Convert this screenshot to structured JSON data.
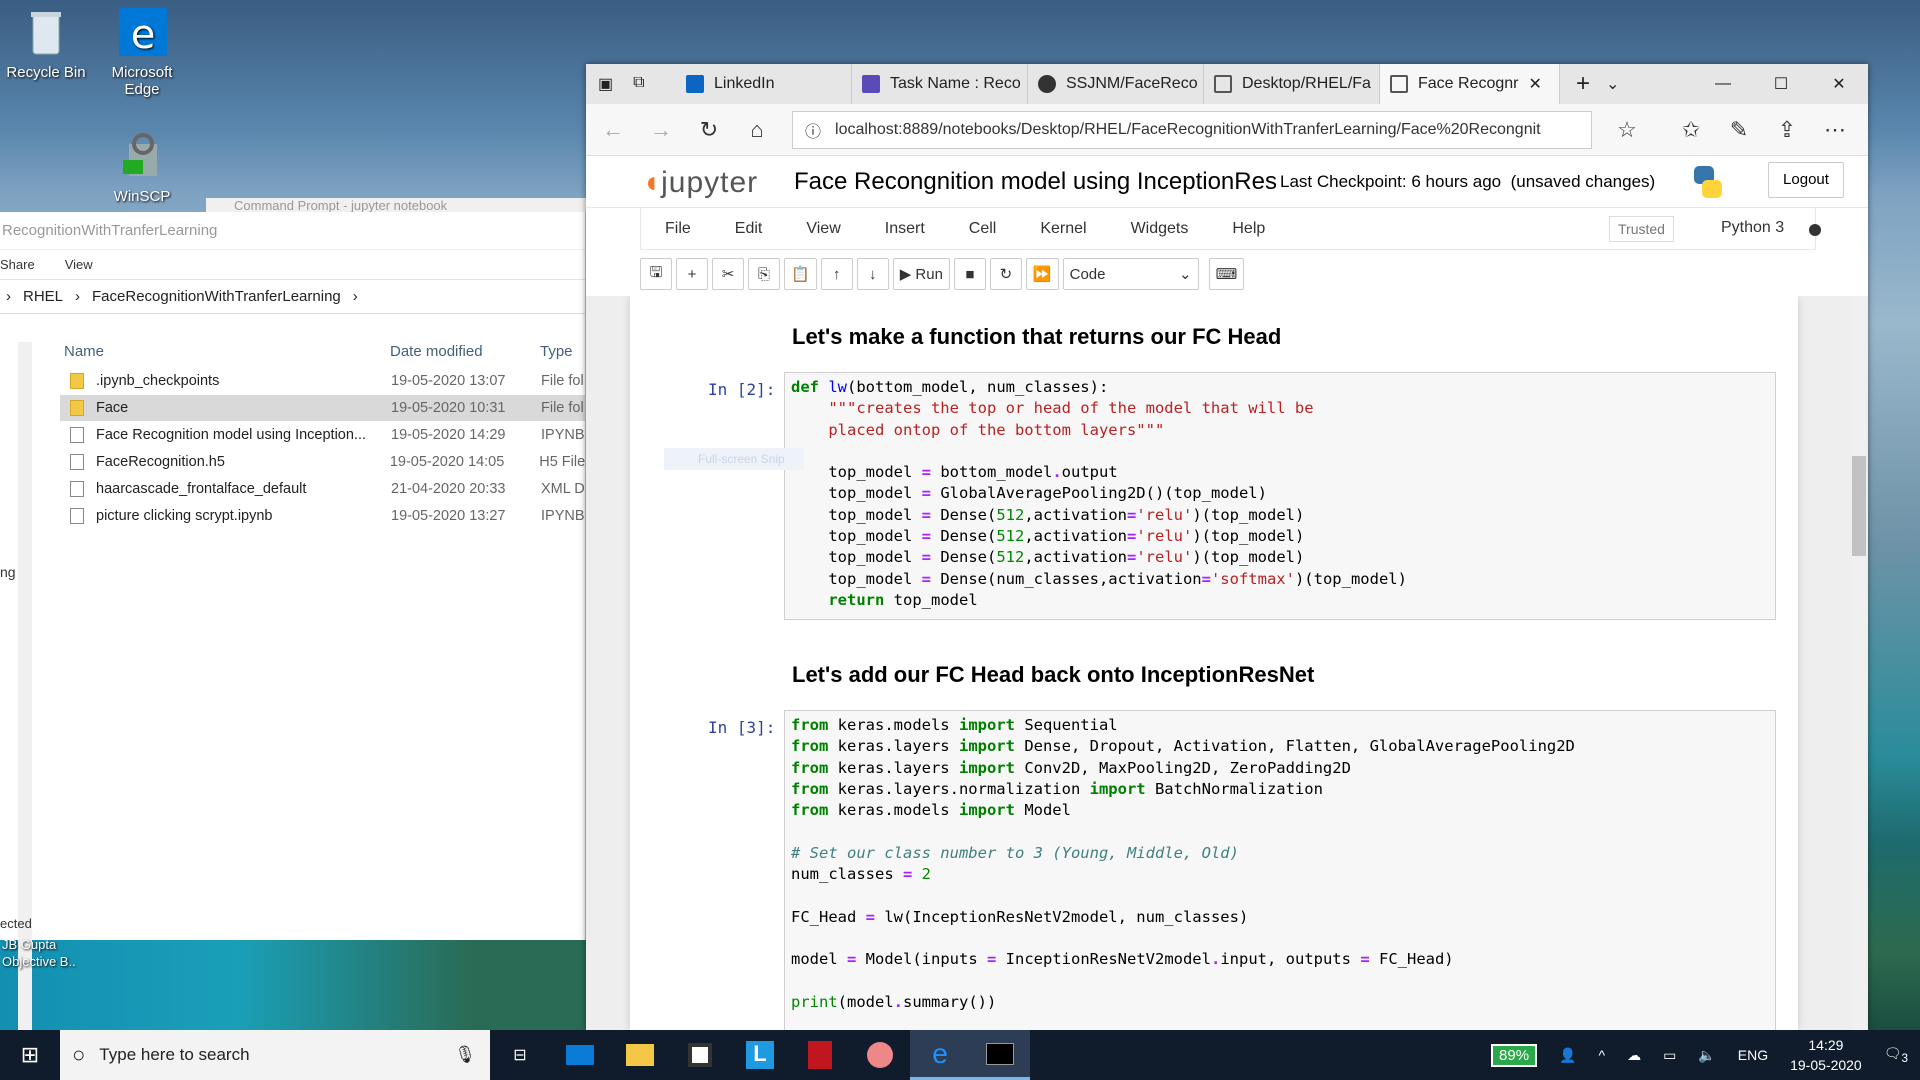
{
  "desktop": {
    "icons": [
      {
        "label": "Recycle Bin"
      },
      {
        "label": "Microsoft Edge"
      },
      {
        "label": "WinSCP"
      }
    ],
    "cmd_title": "Command Prompt - jupyter  notebook",
    "bottom_text": [
      "JB Gupta",
      "Objective  B.."
    ]
  },
  "explorer": {
    "title": "RecognitionWithTranferLearning",
    "ribbon": [
      "Share",
      "View"
    ],
    "breadcrumb": [
      "RHEL",
      "FaceRecognitionWithTranferLearning"
    ],
    "columns": [
      "Name",
      "Date modified",
      "Type"
    ],
    "files": [
      {
        "name": ".ipynb_checkpoints",
        "date": "19-05-2020 13:07",
        "type": "File fol"
      },
      {
        "name": "Face",
        "date": "19-05-2020 10:31",
        "type": "File fol"
      },
      {
        "name": "Face Recognition model using Inception...",
        "date": "19-05-2020 14:29",
        "type": "IPYNB"
      },
      {
        "name": "FaceRecognition.h5",
        "date": "19-05-2020 14:05",
        "type": "H5 File"
      },
      {
        "name": "haarcascade_frontalface_default",
        "date": "21-04-2020 20:33",
        "type": "XML D"
      },
      {
        "name": "picture clicking scrypt.ipynb",
        "date": "19-05-2020 13:27",
        "type": "IPYNB"
      }
    ],
    "side_text": "ng",
    "status": "ected"
  },
  "browser": {
    "tabs": [
      "LinkedIn",
      "Task Name : Reco",
      "SSJNM/FaceReco",
      "Desktop/RHEL/Fa",
      "Face Recognr"
    ],
    "url": "localhost:8889/notebooks/Desktop/RHEL/FaceRecognitionWithTranferLearning/Face%20Recongnit"
  },
  "jupyter": {
    "logo": "jupyter",
    "title": "Face Recongnition model using InceptionRes",
    "checkpoint": "Last Checkpoint: 6 hours ago",
    "unsaved": "(unsaved changes)",
    "logout": "Logout",
    "menu": [
      "File",
      "Edit",
      "View",
      "Insert",
      "Cell",
      "Kernel",
      "Widgets",
      "Help"
    ],
    "trusted": "Trusted",
    "kernel": "Python 3",
    "run_label": "Run",
    "cell_type": "Code",
    "md1": "Let's make a function that returns our FC Head",
    "md2": "Let's add our FC Head back onto InceptionResNet",
    "prompt2": "In [2]:",
    "prompt3": "In [3]:",
    "snip_hint": "Full-screen Snip"
  },
  "taskbar": {
    "search_placeholder": "Type here to search",
    "battery": "89%",
    "lang": "ENG",
    "time": "14:29",
    "date": "19-05-2020",
    "notif": "3"
  },
  "colors": {
    "jupyter_orange": "#f37726",
    "taskbar": "#101c2c",
    "prompt": "#303f9f"
  }
}
